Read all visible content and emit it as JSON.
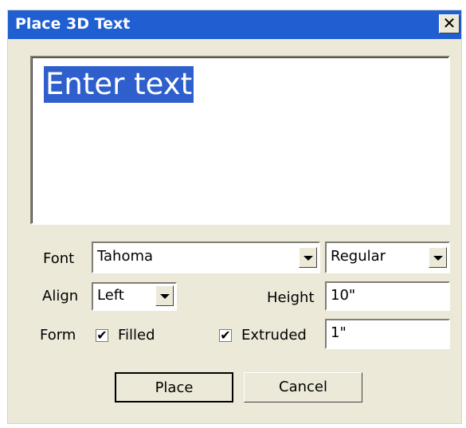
{
  "window": {
    "title": "Place 3D Text",
    "close_glyph": "✕"
  },
  "text_area": {
    "value": "Enter text"
  },
  "font": {
    "label": "Font",
    "family": "Tahoma",
    "style": "Regular"
  },
  "align": {
    "label": "Align",
    "value": "Left"
  },
  "height": {
    "label": "Height",
    "value": "10\""
  },
  "form": {
    "label": "Form",
    "filled": {
      "label": "Filled",
      "checked": true
    },
    "extruded": {
      "label": "Extruded",
      "checked": true,
      "depth": "1\""
    }
  },
  "buttons": {
    "place": "Place",
    "cancel": "Cancel"
  },
  "check_glyph": "✔"
}
